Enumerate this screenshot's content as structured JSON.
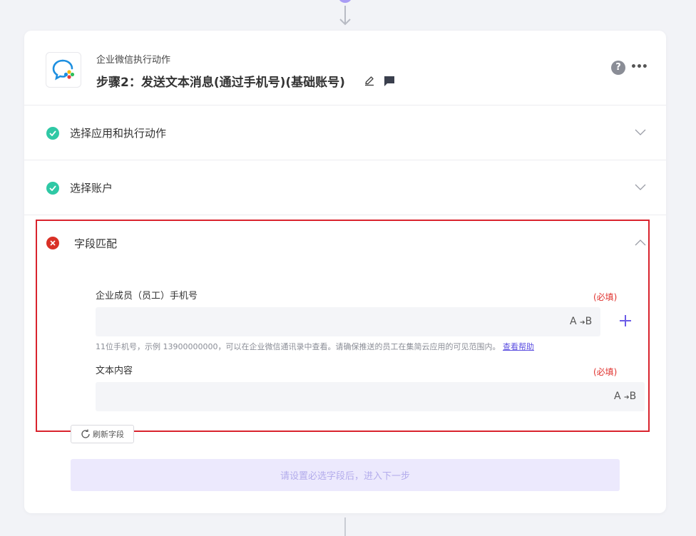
{
  "header": {
    "app_name": "企业微信执行动作",
    "step_title": "步骤2：发送文本消息(通过手机号)(基础账号)",
    "help_label": "?",
    "more_label": "•••"
  },
  "sections": [
    {
      "label": "选择应用和执行动作",
      "status": "complete"
    },
    {
      "label": "选择账户",
      "status": "complete"
    }
  ],
  "field_mapping": {
    "label": "字段匹配",
    "status": "error",
    "fields": [
      {
        "label": "企业成员（员工）手机号",
        "required_label": "(必填)",
        "value": "",
        "ab_label": "A",
        "ab_label_b": "B",
        "hint": "11位手机号，示例 13900000000，可以在企业微信通讯录中查看。请确保推送的员工在集简云应用的可见范围内。",
        "help_link": "查看帮助"
      },
      {
        "label": "文本内容",
        "required_label": "(必填)",
        "value": "",
        "ab_label": "A",
        "ab_label_b": "B"
      }
    ]
  },
  "actions": {
    "refresh_label": "刷新字段",
    "next_label": "请设置必选字段后，进入下一步"
  },
  "colors": {
    "accent": "#6b5ce7",
    "success": "#2fc8a5",
    "error": "#d93026",
    "required": "#e0312d"
  }
}
